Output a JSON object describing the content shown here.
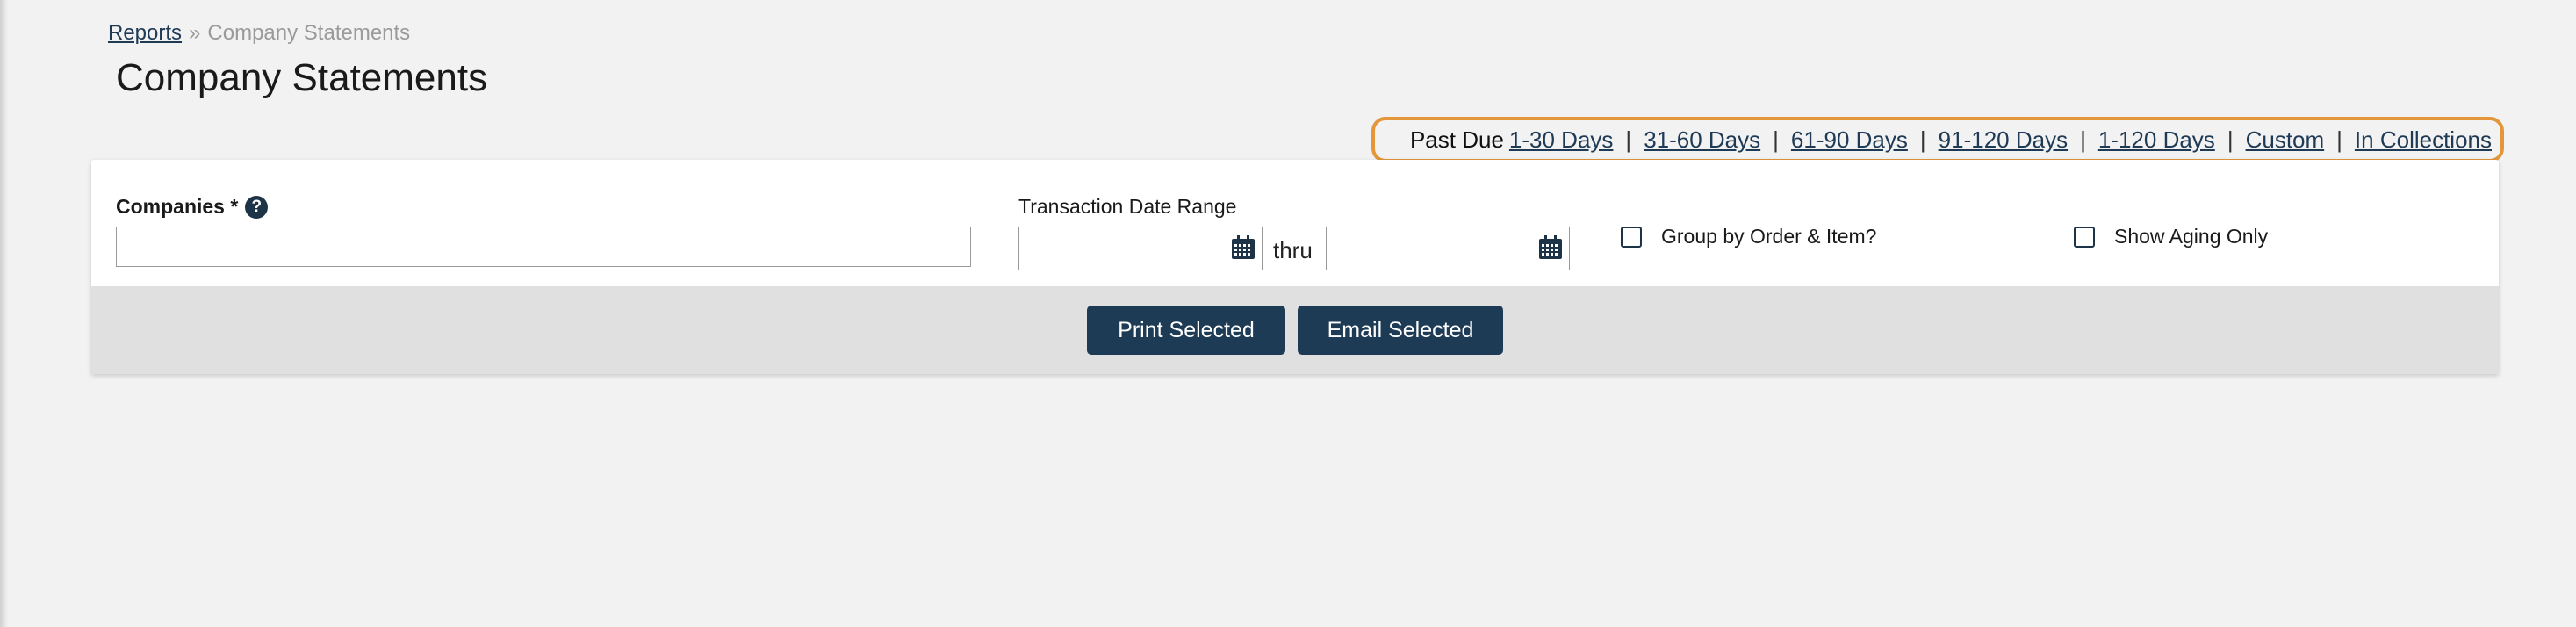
{
  "breadcrumb": {
    "parent": "Reports",
    "separator": "»",
    "current": "Company Statements"
  },
  "page": {
    "title": "Company Statements"
  },
  "past_due": {
    "label": "Past Due",
    "links": [
      "1-30 Days",
      "31-60 Days",
      "61-90 Days",
      "91-120 Days",
      "1-120 Days",
      "Custom",
      "In Collections"
    ],
    "separator": "|",
    "highlight_color": "#e3963a"
  },
  "form": {
    "companies_label": "Companies *",
    "companies_help_icon": "?",
    "companies_value": "",
    "date_range_label": "Transaction Date Range",
    "date_from_value": "",
    "date_to_value": "",
    "thru_label": "thru",
    "group_by_label": "Group by Order & Item?",
    "group_by_checked": false,
    "show_aging_label": "Show Aging Only",
    "show_aging_checked": false
  },
  "actions": {
    "print_label": "Print Selected",
    "email_label": "Email Selected"
  },
  "colors": {
    "primary_button": "#1e3b55",
    "link": "#1f3a55",
    "background": "#f2f2f2"
  }
}
